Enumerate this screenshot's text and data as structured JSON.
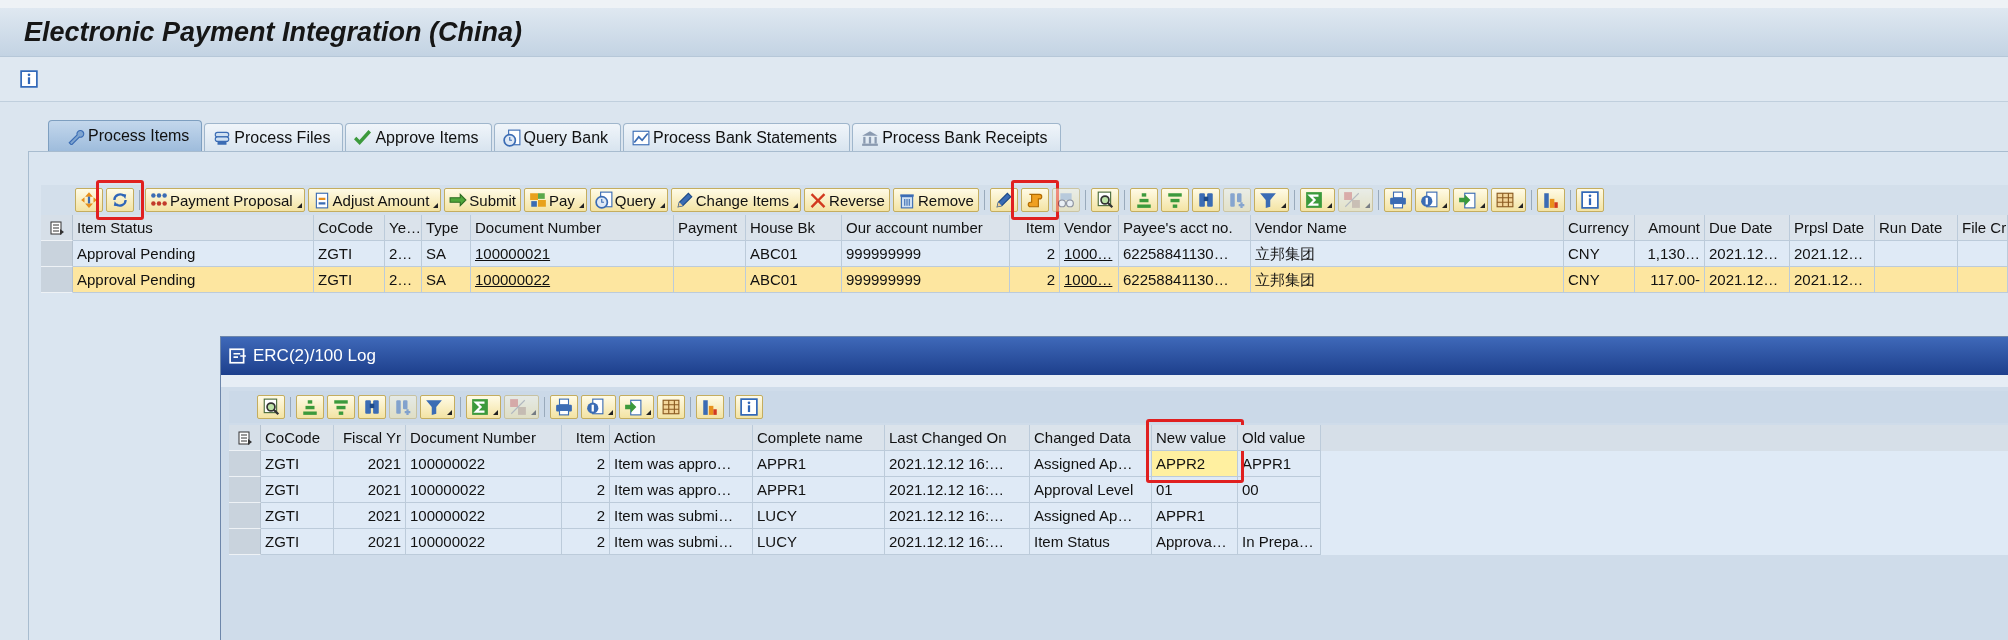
{
  "window": {
    "title": "Electronic Payment Integration (China)"
  },
  "tabs": [
    {
      "label": "Process Items",
      "selected": true
    },
    {
      "label": "Process Files",
      "selected": false
    },
    {
      "label": "Approve Items",
      "selected": false
    },
    {
      "label": "Query Bank",
      "selected": false
    },
    {
      "label": "Process Bank Statements",
      "selected": false
    },
    {
      "label": "Process Bank Receipts",
      "selected": false
    }
  ],
  "toolbar": [
    {
      "kind": "icon",
      "dropdown": false,
      "disabled": false,
      "highlighted": false
    },
    {
      "kind": "icon",
      "dropdown": false,
      "disabled": false,
      "highlighted": true
    },
    {
      "kind": "separator"
    },
    {
      "kind": "button",
      "label": "Payment Proposal",
      "dropdown": true,
      "disabled": false,
      "highlighted": false
    },
    {
      "kind": "button",
      "label": "Adjust Amount",
      "dropdown": true,
      "disabled": false,
      "highlighted": false
    },
    {
      "kind": "button",
      "label": "Submit",
      "dropdown": false,
      "disabled": false,
      "highlighted": false
    },
    {
      "kind": "button",
      "label": "Pay",
      "dropdown": true,
      "disabled": false,
      "highlighted": false
    },
    {
      "kind": "button",
      "label": "Query",
      "dropdown": true,
      "disabled": false,
      "highlighted": false
    },
    {
      "kind": "button",
      "label": "Change Items",
      "dropdown": true,
      "disabled": false,
      "highlighted": false
    },
    {
      "kind": "button",
      "label": "Reverse",
      "dropdown": false,
      "disabled": false,
      "highlighted": false
    },
    {
      "kind": "button",
      "label": "Remove",
      "dropdown": false,
      "disabled": false,
      "highlighted": false
    },
    {
      "kind": "separator"
    },
    {
      "kind": "icon",
      "dropdown": false,
      "disabled": false,
      "highlighted": false
    },
    {
      "kind": "icon",
      "dropdown": false,
      "disabled": false,
      "highlighted": true
    },
    {
      "kind": "icon",
      "dropdown": false,
      "disabled": true,
      "highlighted": false
    },
    {
      "kind": "separator"
    },
    {
      "kind": "icon",
      "dropdown": false,
      "disabled": false,
      "highlighted": false
    },
    {
      "kind": "separator"
    },
    {
      "kind": "icon",
      "dropdown": false,
      "disabled": false,
      "highlighted": false
    },
    {
      "kind": "icon",
      "dropdown": false,
      "disabled": false,
      "highlighted": false
    },
    {
      "kind": "icon",
      "dropdown": false,
      "disabled": false,
      "highlighted": false
    },
    {
      "kind": "icon",
      "dropdown": false,
      "disabled": true,
      "highlighted": false
    },
    {
      "kind": "icon",
      "dropdown": true,
      "disabled": false,
      "highlighted": false
    },
    {
      "kind": "separator"
    },
    {
      "kind": "icon",
      "dropdown": true,
      "disabled": false,
      "highlighted": false
    },
    {
      "kind": "icon",
      "dropdown": true,
      "disabled": true,
      "highlighted": false
    },
    {
      "kind": "separator"
    },
    {
      "kind": "icon",
      "dropdown": false,
      "disabled": false,
      "highlighted": false
    },
    {
      "kind": "icon",
      "dropdown": true,
      "disabled": false,
      "highlighted": false
    },
    {
      "kind": "icon",
      "dropdown": true,
      "disabled": false,
      "highlighted": false
    },
    {
      "kind": "icon",
      "dropdown": true,
      "disabled": false,
      "highlighted": false
    },
    {
      "kind": "separator"
    },
    {
      "kind": "icon",
      "dropdown": false,
      "disabled": false,
      "highlighted": false
    },
    {
      "kind": "separator"
    },
    {
      "kind": "icon",
      "dropdown": false,
      "disabled": false,
      "highlighted": false
    }
  ],
  "table": {
    "columns": [
      {
        "label": "Item Status"
      },
      {
        "label": "CoCode"
      },
      {
        "label": "Ye…"
      },
      {
        "label": "Type"
      },
      {
        "label": "Document Number",
        "link": true
      },
      {
        "label": "Payment"
      },
      {
        "label": "House Bk"
      },
      {
        "label": "Our account number"
      },
      {
        "label": "Item"
      },
      {
        "label": "Vendor",
        "link": true
      },
      {
        "label": "Payee's acct no."
      },
      {
        "label": "Vendor Name"
      },
      {
        "label": "Currency"
      },
      {
        "label": "Amount"
      },
      {
        "label": "Due Date"
      },
      {
        "label": "Prpsl Date"
      },
      {
        "label": "Run Date"
      },
      {
        "label": "File Cr"
      }
    ],
    "rows": [
      {
        "selected": false,
        "cells": [
          "Approval Pending",
          "ZGTI",
          "2…",
          "SA",
          "100000021",
          null,
          "ABC01",
          "999999999",
          "2",
          "1000…",
          "62258841130…",
          "立邦集团",
          "CNY",
          "1,130…",
          "2021.12…",
          "2021.12…",
          null,
          null
        ]
      },
      {
        "selected": true,
        "cells": [
          "Approval Pending",
          "ZGTI",
          "2…",
          "SA",
          "100000022",
          null,
          "ABC01",
          "999999999",
          "2",
          "1000…",
          "62258841130…",
          "立邦集团",
          "CNY",
          "117.00-",
          "2021.12…",
          "2021.12…",
          null,
          null
        ]
      }
    ]
  },
  "log_window": {
    "title": "ERC(2)/100 Log",
    "toolbar": [
      {
        "kind": "icon",
        "dropdown": false,
        "disabled": false
      },
      {
        "kind": "separator"
      },
      {
        "kind": "icon",
        "dropdown": false,
        "disabled": false
      },
      {
        "kind": "icon",
        "dropdown": false,
        "disabled": false
      },
      {
        "kind": "icon",
        "dropdown": false,
        "disabled": false
      },
      {
        "kind": "icon",
        "dropdown": false,
        "disabled": true
      },
      {
        "kind": "icon",
        "dropdown": true,
        "disabled": false
      },
      {
        "kind": "separator"
      },
      {
        "kind": "icon",
        "dropdown": true,
        "disabled": false
      },
      {
        "kind": "icon",
        "dropdown": true,
        "disabled": true
      },
      {
        "kind": "separator"
      },
      {
        "kind": "icon",
        "dropdown": false,
        "disabled": false
      },
      {
        "kind": "icon",
        "dropdown": true,
        "disabled": false
      },
      {
        "kind": "icon",
        "dropdown": true,
        "disabled": false
      },
      {
        "kind": "icon",
        "dropdown": false,
        "disabled": false
      },
      {
        "kind": "separator"
      },
      {
        "kind": "icon",
        "dropdown": false,
        "disabled": false
      },
      {
        "kind": "separator"
      },
      {
        "kind": "icon",
        "dropdown": false,
        "disabled": false
      }
    ],
    "table": {
      "columns": [
        {
          "label": "CoCode"
        },
        {
          "label": "Fiscal Yr"
        },
        {
          "label": "Document Number"
        },
        {
          "label": "Item"
        },
        {
          "label": "Action"
        },
        {
          "label": "Complete name"
        },
        {
          "label": "Last Changed On"
        },
        {
          "label": "Changed Data"
        },
        {
          "label": "New value",
          "highlighted": true,
          "current": true
        },
        {
          "label": "Old value"
        }
      ],
      "rows": [
        {
          "current": true,
          "cells": [
            "ZGTI",
            "2021",
            "100000022",
            "2",
            "Item was appro…",
            "APPR1",
            "2021.12.12 16:…",
            "Assigned Ap…",
            "APPR2",
            "APPR1"
          ]
        },
        {
          "current": false,
          "cells": [
            "ZGTI",
            "2021",
            "100000022",
            "2",
            "Item was appro…",
            "APPR1",
            "2021.12.12 16:…",
            "Approval Level",
            "01",
            "00"
          ]
        },
        {
          "current": false,
          "cells": [
            "ZGTI",
            "2021",
            "100000022",
            "2",
            "Item was submi…",
            "LUCY",
            "2021.12.12 16:…",
            "Assigned Ap…",
            "APPR1",
            null
          ]
        },
        {
          "current": false,
          "cells": [
            "ZGTI",
            "2021",
            "100000022",
            "2",
            "Item was submi…",
            "LUCY",
            "2021.12.12 16:…",
            "Item Status",
            "Approva…",
            "In Prepa…"
          ]
        }
      ]
    }
  }
}
